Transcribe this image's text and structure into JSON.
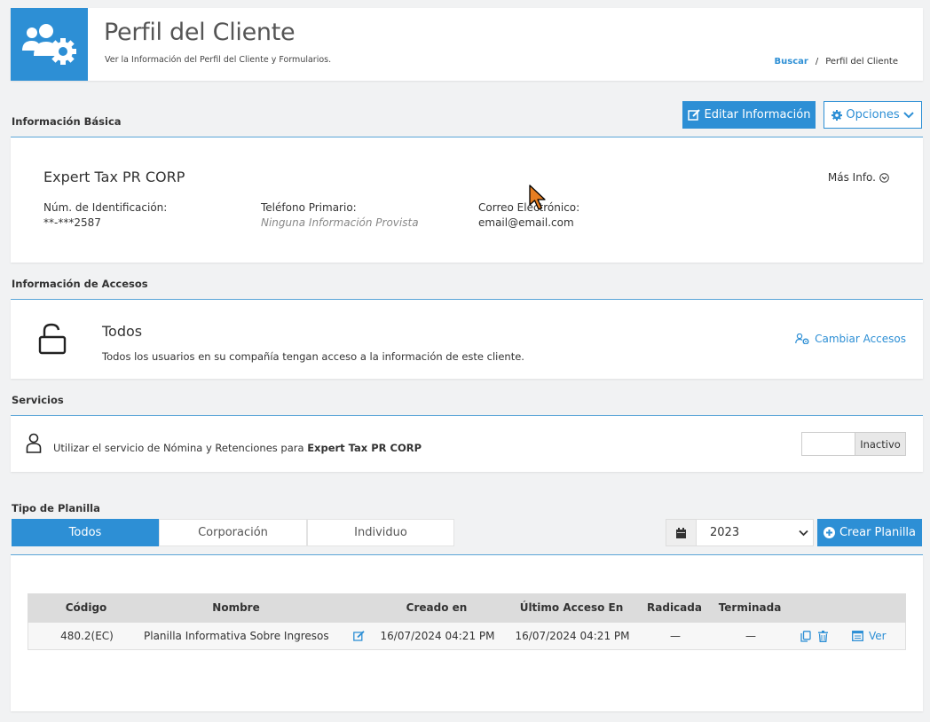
{
  "header": {
    "title": "Perfil del Cliente",
    "subtitle": "Ver la Información del Perfil del Cliente y Formularios.",
    "breadcrumb": {
      "link": "Buscar",
      "separator": "/",
      "current": "Perfil del Cliente"
    }
  },
  "basic_info": {
    "section_title": "Información Básica",
    "edit_button": "Editar Información",
    "options_button": "Opciones",
    "client_name": "Expert Tax PR CORP",
    "more_info": "Más Info.",
    "fields": [
      {
        "label": "Núm. de Identificación:",
        "value": "**-***2587"
      },
      {
        "label": "Teléfono Primario:",
        "value": "Ninguna Información Provista"
      },
      {
        "label": "Correo Electrónico:",
        "value": "email@email.com"
      }
    ]
  },
  "access": {
    "section_title": "Información de Accesos",
    "title": "Todos",
    "description": "Todos los usuarios en su compañía tengan acceso a la información de este cliente.",
    "change_button": "Cambiar Accesos"
  },
  "services": {
    "section_title": "Servicios",
    "text_prefix": "Utilizar el servicio de Nómina y Retenciones para",
    "text_bold": "Expert Tax PR CORP",
    "toggle_label": "Inactivo"
  },
  "forms": {
    "section_title": "Tipo de Planilla",
    "tabs": [
      {
        "label": "Todos",
        "active": true
      },
      {
        "label": "Corporación",
        "active": false
      },
      {
        "label": "Individuo",
        "active": false
      }
    ],
    "year": "2023",
    "create_button": "Crear Planilla",
    "columns": [
      "Código",
      "Nombre",
      "Creado en",
      "Último Acceso En",
      "Radicada",
      "Terminada"
    ],
    "rows": [
      {
        "code": "480.2(EC)",
        "name": "Planilla Informativa Sobre Ingresos d...",
        "created": "16/07/2024 04:21 PM",
        "last_access": "16/07/2024 04:21 PM",
        "filed": "—",
        "finished": "—",
        "view_label": "Ver"
      }
    ]
  },
  "colors": {
    "accent": "#2d8fd5",
    "background": "#f1f2f3"
  }
}
